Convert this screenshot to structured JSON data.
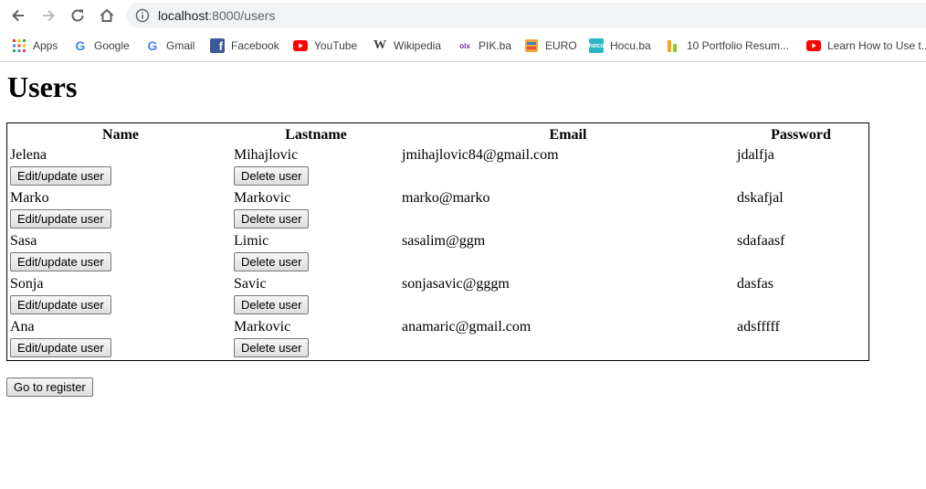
{
  "browser": {
    "url_host": "localhost",
    "url_rest": ":8000/users",
    "bookmarks": [
      {
        "label": "Apps",
        "icon": "apps-grid-icon"
      },
      {
        "label": "Google",
        "icon": "google-icon"
      },
      {
        "label": "Gmail",
        "icon": "google-icon"
      },
      {
        "label": "Facebook",
        "icon": "facebook-icon"
      },
      {
        "label": "YouTube",
        "icon": "youtube-icon"
      },
      {
        "label": "Wikipedia",
        "icon": "wikipedia-icon"
      },
      {
        "label": "PIK.ba",
        "icon": "olx-icon"
      },
      {
        "label": "EURO",
        "icon": "euro-icon"
      },
      {
        "label": "Hocu.ba",
        "icon": "hocu-icon"
      },
      {
        "label": "10 Portfolio Resum...",
        "icon": "portfolio-icon"
      },
      {
        "label": "Learn How to Use t...",
        "icon": "youtube-icon"
      }
    ]
  },
  "page": {
    "title": "Users",
    "headers": [
      "Name",
      "Lastname",
      "Email",
      "Password"
    ],
    "edit_label": "Edit/update user",
    "delete_label": "Delete user",
    "register_label": "Go to register",
    "users": [
      {
        "name": "Jelena",
        "lastname": "Mihajlovic",
        "email": "jmihajlovic84@gmail.com",
        "password": "jdalfja"
      },
      {
        "name": "Marko",
        "lastname": "Markovic",
        "email": "marko@marko",
        "password": "dskafjal"
      },
      {
        "name": "Sasa",
        "lastname": "Limic",
        "email": "sasalim@ggm",
        "password": "sdafaasf"
      },
      {
        "name": "Sonja",
        "lastname": "Savic",
        "email": "sonjasavic@gggm",
        "password": "dasfas"
      },
      {
        "name": "Ana",
        "lastname": "Markovic",
        "email": "anamaric@gmail.com",
        "password": "adsfffff"
      }
    ]
  }
}
